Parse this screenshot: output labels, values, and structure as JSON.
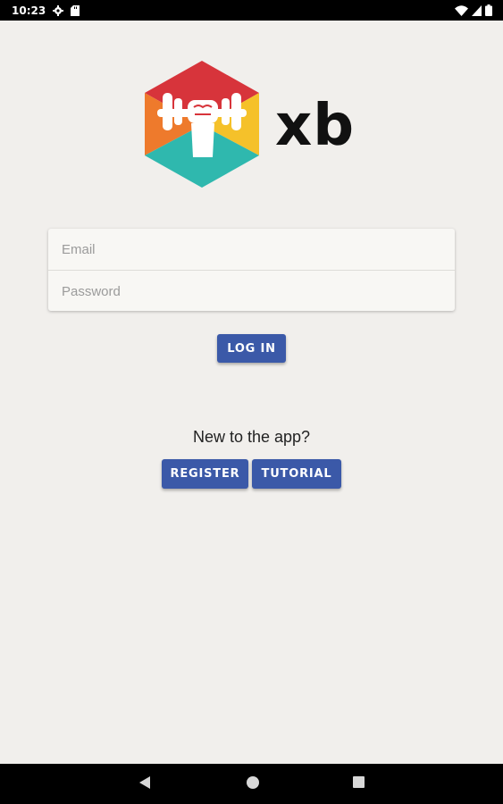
{
  "status_bar": {
    "time": "10:23",
    "icons_left": [
      "settings-icon",
      "sd-card-icon"
    ],
    "icons_right": [
      "wifi-icon",
      "signal-icon",
      "battery-icon"
    ]
  },
  "app": {
    "logo_text": "xb",
    "logo_icon": "hexagon-fist-dumbbell-logo"
  },
  "login_form": {
    "email_placeholder": "Email",
    "email_value": "",
    "password_placeholder": "Password",
    "password_value": "",
    "login_label": "LOG IN"
  },
  "signup": {
    "prompt": "New to the app?",
    "register_label": "REGISTER",
    "tutorial_label": "TUTORIAL"
  },
  "colors": {
    "background": "#f1efec",
    "button": "#3b59a8",
    "logo_red": "#d7343b",
    "logo_orange": "#ee7a2c",
    "logo_yellow": "#f5c12a",
    "logo_teal": "#2fb8ae"
  },
  "nav_bar": {
    "icons": [
      "back-icon",
      "home-icon",
      "recents-icon"
    ]
  }
}
